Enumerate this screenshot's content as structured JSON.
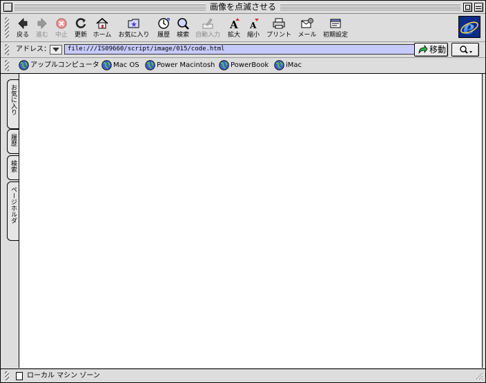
{
  "window": {
    "title": "画像を点滅させる"
  },
  "toolbar": {
    "back": "戻る",
    "forward": "進む",
    "stop": "中止",
    "refresh": "更新",
    "home": "ホーム",
    "favorites": "お気に入り",
    "history": "履歴",
    "search": "検索",
    "autofill": "自動入力",
    "larger": "拡大",
    "smaller": "縮小",
    "print": "プリント",
    "mail": "メール",
    "preferences": "初期設定"
  },
  "address": {
    "label": "アドレス：",
    "url": "file:///IS09660/script/image/015/code.html",
    "go_label": "移動"
  },
  "favorites_bar": {
    "items": [
      "アップルコンピュータ",
      "Mac OS",
      "Power Macintosh",
      "PowerBook",
      "iMac"
    ]
  },
  "sidebar": {
    "tabs": [
      "お気に入り",
      "履歴",
      "検索",
      "ページホルダ"
    ]
  },
  "status": {
    "text": "ローカル マシン ゾーン"
  },
  "colors": {
    "address_highlight": "#c6cafb",
    "ie_logo_bg": "#0b2c88",
    "chrome": "#dddddd",
    "stop_red": "#e23b3b"
  },
  "icons": {
    "back": "left-arrow-icon",
    "forward": "right-arrow-icon",
    "stop": "stop-icon",
    "refresh": "refresh-icon",
    "home": "home-icon",
    "favorites": "favorites-folder-icon",
    "history": "history-clock-icon",
    "search": "search-magnifier-icon",
    "autofill": "autofill-pen-icon",
    "larger": "text-larger-icon",
    "smaller": "text-smaller-icon",
    "print": "printer-icon",
    "mail": "mail-icon",
    "preferences": "preferences-icon",
    "fav_item": "globe-icon"
  }
}
